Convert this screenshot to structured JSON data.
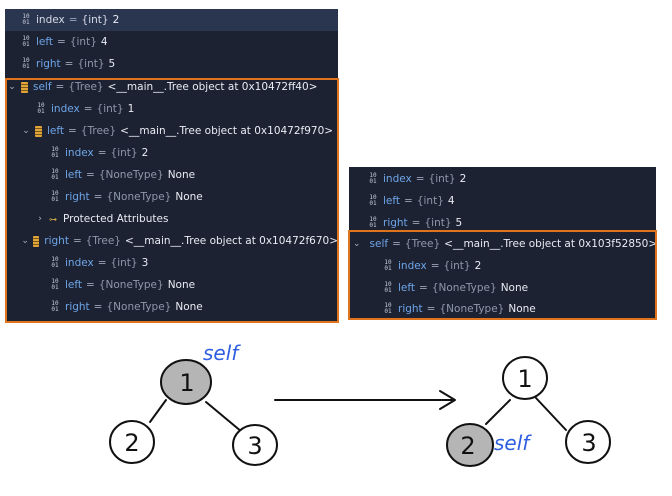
{
  "left_panel": {
    "rows": [
      {
        "name": "index",
        "type": "{int}",
        "value": "2",
        "selected": true,
        "plain": true
      },
      {
        "name": "left",
        "type": "{int}",
        "value": "4"
      },
      {
        "name": "right",
        "type": "{int}",
        "value": "5"
      },
      {
        "name": "self",
        "type": "{Tree}",
        "value": "<__main__.Tree object at 0x10472ff40>",
        "expand": "v"
      },
      {
        "name": "index",
        "type": "{int}",
        "value": "1"
      },
      {
        "name": "left",
        "type": "{Tree}",
        "value": "<__main__.Tree object at 0x10472f970>",
        "expand": "v"
      },
      {
        "name": "index",
        "type": "{int}",
        "value": "2"
      },
      {
        "name": "left",
        "type": "{NoneType}",
        "value": "None"
      },
      {
        "name": "right",
        "type": "{NoneType}",
        "value": "None"
      },
      {
        "label": "Protected Attributes",
        "expand": ">"
      },
      {
        "name": "right",
        "type": "{Tree}",
        "value": "<__main__.Tree object at 0x10472f670>",
        "expand": "v"
      },
      {
        "name": "index",
        "type": "{int}",
        "value": "3"
      },
      {
        "name": "left",
        "type": "{NoneType}",
        "value": "None"
      },
      {
        "name": "right",
        "type": "{NoneType}",
        "value": "None"
      }
    ]
  },
  "right_panel": {
    "rows": [
      {
        "name": "index",
        "type": "{int}",
        "value": "2"
      },
      {
        "name": "left",
        "type": "{int}",
        "value": "4"
      },
      {
        "name": "right",
        "type": "{int}",
        "value": "5"
      },
      {
        "name": "self",
        "type": "{Tree}",
        "value": "<__main__.Tree object at 0x103f52850>",
        "expand": "v"
      },
      {
        "name": "index",
        "type": "{int}",
        "value": "2"
      },
      {
        "name": "left",
        "type": "{NoneType}",
        "value": "None"
      },
      {
        "name": "right",
        "type": "{NoneType}",
        "value": "None"
      }
    ]
  },
  "diagram": {
    "before": {
      "root": "1",
      "left": "2",
      "right": "3",
      "pointer_label": "self"
    },
    "after": {
      "root": "1",
      "left": "2",
      "right": "3",
      "pointer_label": "self"
    }
  },
  "colors": {
    "highlight_box": "#e0741c",
    "pointer_text": "#2f5fe0",
    "selected_node_fill": "#b5b5b5"
  }
}
